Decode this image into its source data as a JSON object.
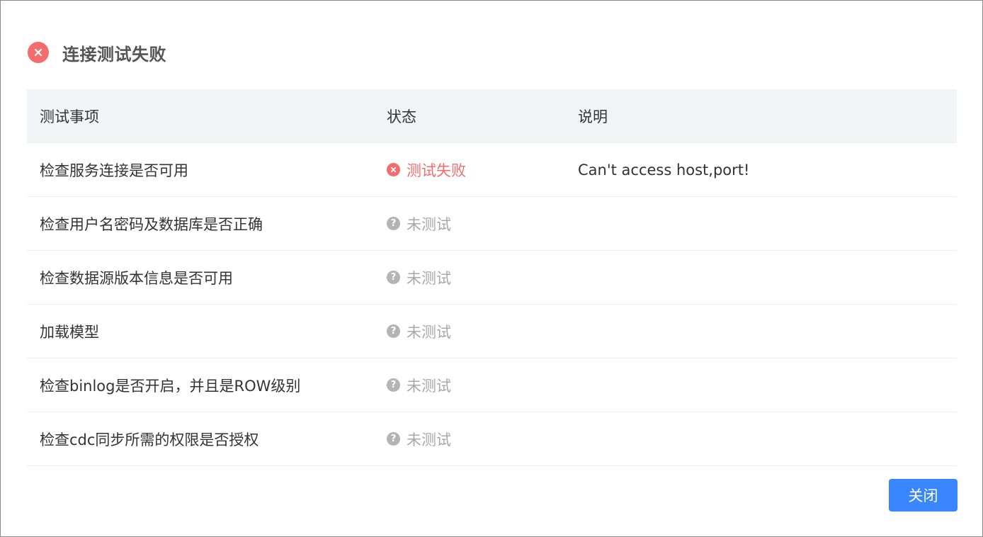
{
  "dialog": {
    "title": "连接测试失败",
    "title_icon": "error-circle-icon"
  },
  "table": {
    "columns": [
      "测试事项",
      "状态",
      "说明"
    ],
    "rows": [
      {
        "item": "检查服务连接是否可用",
        "status": "测试失败",
        "status_type": "fail",
        "status_icon": "error-circle-icon",
        "description": "Can't access host,port!"
      },
      {
        "item": "检查用户名密码及数据库是否正确",
        "status": "未测试",
        "status_type": "untested",
        "status_icon": "question-circle-icon",
        "description": ""
      },
      {
        "item": "检查数据源版本信息是否可用",
        "status": "未测试",
        "status_type": "untested",
        "status_icon": "question-circle-icon",
        "description": ""
      },
      {
        "item": "加载模型",
        "status": "未测试",
        "status_type": "untested",
        "status_icon": "question-circle-icon",
        "description": ""
      },
      {
        "item": "检查binlog是否开启，并且是ROW级别",
        "status": "未测试",
        "status_type": "untested",
        "status_icon": "question-circle-icon",
        "description": ""
      },
      {
        "item": "检查cdc同步所需的权限是否授权",
        "status": "未测试",
        "status_type": "untested",
        "status_icon": "question-circle-icon",
        "description": ""
      }
    ]
  },
  "footer": {
    "close_label": "关闭"
  },
  "colors": {
    "error": "#f56c6c",
    "untested": "#a8a8a8",
    "primary": "#3a86ff",
    "header_bg": "#f3f4f6"
  }
}
